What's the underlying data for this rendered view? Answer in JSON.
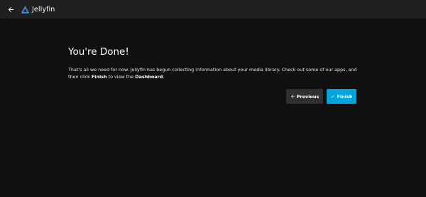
{
  "header": {
    "back_icon": "arrow-left-icon",
    "logo_icon": "jellyfin-logo-icon",
    "app_name": "Jellyfin"
  },
  "main": {
    "title": "You're Done!",
    "description_part1": "That's all we need for now. Jellyfin has begun collecting information about your media library. Check out some of our apps, and then click ",
    "description_finish": "Finish",
    "description_part2": " to view the ",
    "description_dashboard": "Dashboard",
    "description_end": "."
  },
  "buttons": {
    "previous_label": "Previous",
    "previous_icon": "arrow-left-icon",
    "finish_label": "Finish",
    "finish_icon": "check-icon"
  },
  "colors": {
    "background": "#101010",
    "topbar": "#202020",
    "accent": "#00a4dc",
    "secondary_button": "#303030"
  }
}
